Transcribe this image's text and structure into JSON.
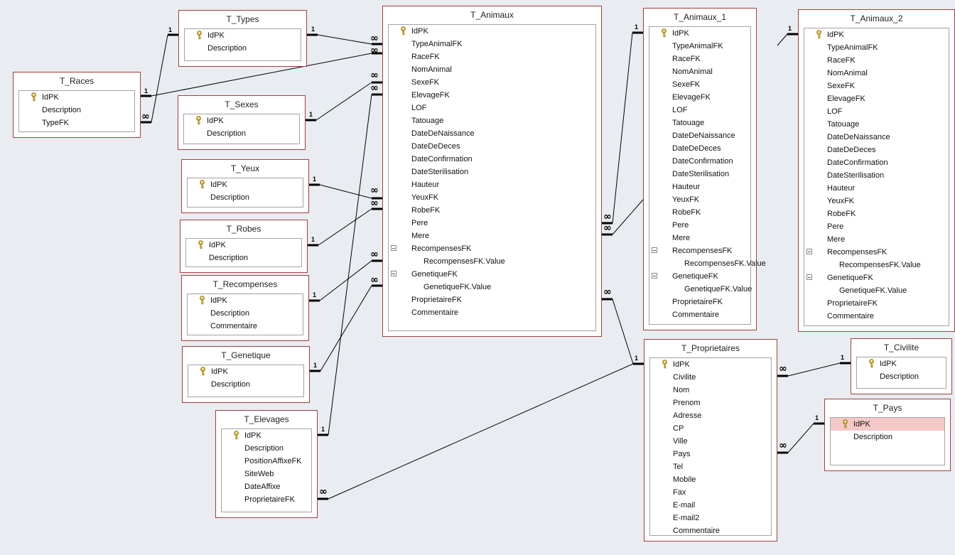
{
  "colors": {
    "background": "#e9ecf0",
    "table_border": "#a0403f",
    "list_border": "#a3a3a3",
    "selected_row": "#f6c9c9",
    "line": "#000000"
  },
  "icons": {
    "primary_key": "key-icon",
    "group_toggle": "collapse-icon"
  },
  "tables": [
    {
      "id": "T_Types",
      "title": "T_Types",
      "pk": "IdPK",
      "fields": [
        "Description"
      ]
    },
    {
      "id": "T_Races",
      "title": "T_Races",
      "pk": "IdPK",
      "fields": [
        "Description",
        "TypeFK"
      ]
    },
    {
      "id": "T_Sexes",
      "title": "T_Sexes",
      "pk": "IdPK",
      "fields": [
        "Description"
      ]
    },
    {
      "id": "T_Yeux",
      "title": "T_Yeux",
      "pk": "IdPK",
      "fields": [
        "Description"
      ]
    },
    {
      "id": "T_Robes",
      "title": "T_Robes",
      "pk": "IdPK",
      "fields": [
        "Description"
      ]
    },
    {
      "id": "T_Recompenses",
      "title": "T_Recompenses",
      "pk": "IdPK",
      "fields": [
        "Description",
        "Commentaire"
      ]
    },
    {
      "id": "T_Genetique",
      "title": "T_Genetique",
      "pk": "IdPK",
      "fields": [
        "Description"
      ]
    },
    {
      "id": "T_Elevages",
      "title": "T_Elevages",
      "pk": "IdPK",
      "fields": [
        "Description",
        "PositionAffixeFK",
        "SiteWeb",
        "DateAffixe",
        "ProprietaireFK"
      ]
    },
    {
      "id": "T_Animaux",
      "title": "T_Animaux",
      "pk": "IdPK",
      "fields": [
        "TypeAnimalFK",
        "RaceFK",
        "NomAnimal",
        "SexeFK",
        "ElevageFK",
        "LOF",
        "Tatouage",
        "DateDeNaissance",
        "DateDeDeces",
        "DateConfirmation",
        "DateSterilisation",
        "Hauteur",
        "YeuxFK",
        "RobeFK",
        "Pere",
        "Mere",
        {
          "group": "RecompensesFK",
          "child": "RecompensesFK.Value"
        },
        {
          "group": "GenetiqueFK",
          "child": "GenetiqueFK.Value"
        },
        "ProprietaireFK",
        "Commentaire"
      ]
    },
    {
      "id": "T_Animaux_1",
      "title": "T_Animaux_1",
      "pk": "IdPK",
      "fields": [
        "TypeAnimalFK",
        "RaceFK",
        "NomAnimal",
        "SexeFK",
        "ElevageFK",
        "LOF",
        "Tatouage",
        "DateDeNaissance",
        "DateDeDeces",
        "DateConfirmation",
        "DateSterilisation",
        "Hauteur",
        "YeuxFK",
        "RobeFK",
        "Pere",
        "Mere",
        {
          "group": "RecompensesFK",
          "child": "RecompensesFK.Value"
        },
        {
          "group": "GenetiqueFK",
          "child": "GenetiqueFK.Value"
        },
        "ProprietaireFK",
        "Commentaire"
      ]
    },
    {
      "id": "T_Animaux_2",
      "title": "T_Animaux_2",
      "pk": "IdPK",
      "fields": [
        "TypeAnimalFK",
        "RaceFK",
        "NomAnimal",
        "SexeFK",
        "ElevageFK",
        "LOF",
        "Tatouage",
        "DateDeNaissance",
        "DateDeDeces",
        "DateConfirmation",
        "DateSterilisation",
        "Hauteur",
        "YeuxFK",
        "RobeFK",
        "Pere",
        "Mere",
        {
          "group": "RecompensesFK",
          "child": "RecompensesFK.Value"
        },
        {
          "group": "GenetiqueFK",
          "child": "GenetiqueFK.Value"
        },
        "ProprietaireFK",
        "Commentaire"
      ]
    },
    {
      "id": "T_Proprietaires",
      "title": "T_Proprietaires",
      "pk": "IdPK",
      "fields": [
        "Civilite",
        "Nom",
        "Prenom",
        "Adresse",
        "CP",
        "Ville",
        "Pays",
        "Tel",
        "Mobile",
        "Fax",
        "E-mail",
        "E-mail2",
        "Commentaire"
      ]
    },
    {
      "id": "T_Civilite",
      "title": "T_Civilite",
      "pk": "IdPK",
      "fields": [
        "Description"
      ]
    },
    {
      "id": "T_Pays",
      "title": "T_Pays",
      "pk": "IdPK",
      "pk_selected": true,
      "fields": [
        "Description"
      ]
    }
  ],
  "relationships": [
    {
      "from": "T_Types",
      "to": "T_Animaux",
      "one": "1",
      "many": "∞"
    },
    {
      "from": "T_Races",
      "to": "T_Animaux",
      "one": "1",
      "many": "∞"
    },
    {
      "from": "T_Types",
      "to": "T_Races",
      "one": "1",
      "many": "∞"
    },
    {
      "from": "T_Sexes",
      "to": "T_Animaux",
      "one": "1",
      "many": "∞"
    },
    {
      "from": "T_Yeux",
      "to": "T_Animaux",
      "one": "1",
      "many": "∞"
    },
    {
      "from": "T_Robes",
      "to": "T_Animaux",
      "one": "1",
      "many": "∞"
    },
    {
      "from": "T_Recompenses",
      "to": "T_Animaux",
      "one": "1",
      "many": "∞"
    },
    {
      "from": "T_Genetique",
      "to": "T_Animaux",
      "one": "1",
      "many": "∞"
    },
    {
      "from": "T_Elevages",
      "to": "T_Animaux",
      "one": "1",
      "many": "∞"
    },
    {
      "from": "T_Animaux_1",
      "to": "T_Animaux",
      "one": "1",
      "many": "∞"
    },
    {
      "from": "T_Animaux_2",
      "to": "T_Animaux",
      "one": "1",
      "many": "∞"
    },
    {
      "from": "T_Proprietaires",
      "to": "T_Animaux",
      "one": "1",
      "many": "∞"
    },
    {
      "from": "T_Proprietaires",
      "to": "T_Elevages",
      "one": "1",
      "many": "∞"
    },
    {
      "from": "T_Civilite",
      "to": "T_Proprietaires",
      "one": "1",
      "many": "∞"
    },
    {
      "from": "T_Pays",
      "to": "T_Proprietaires",
      "one": "1",
      "many": "∞"
    }
  ]
}
